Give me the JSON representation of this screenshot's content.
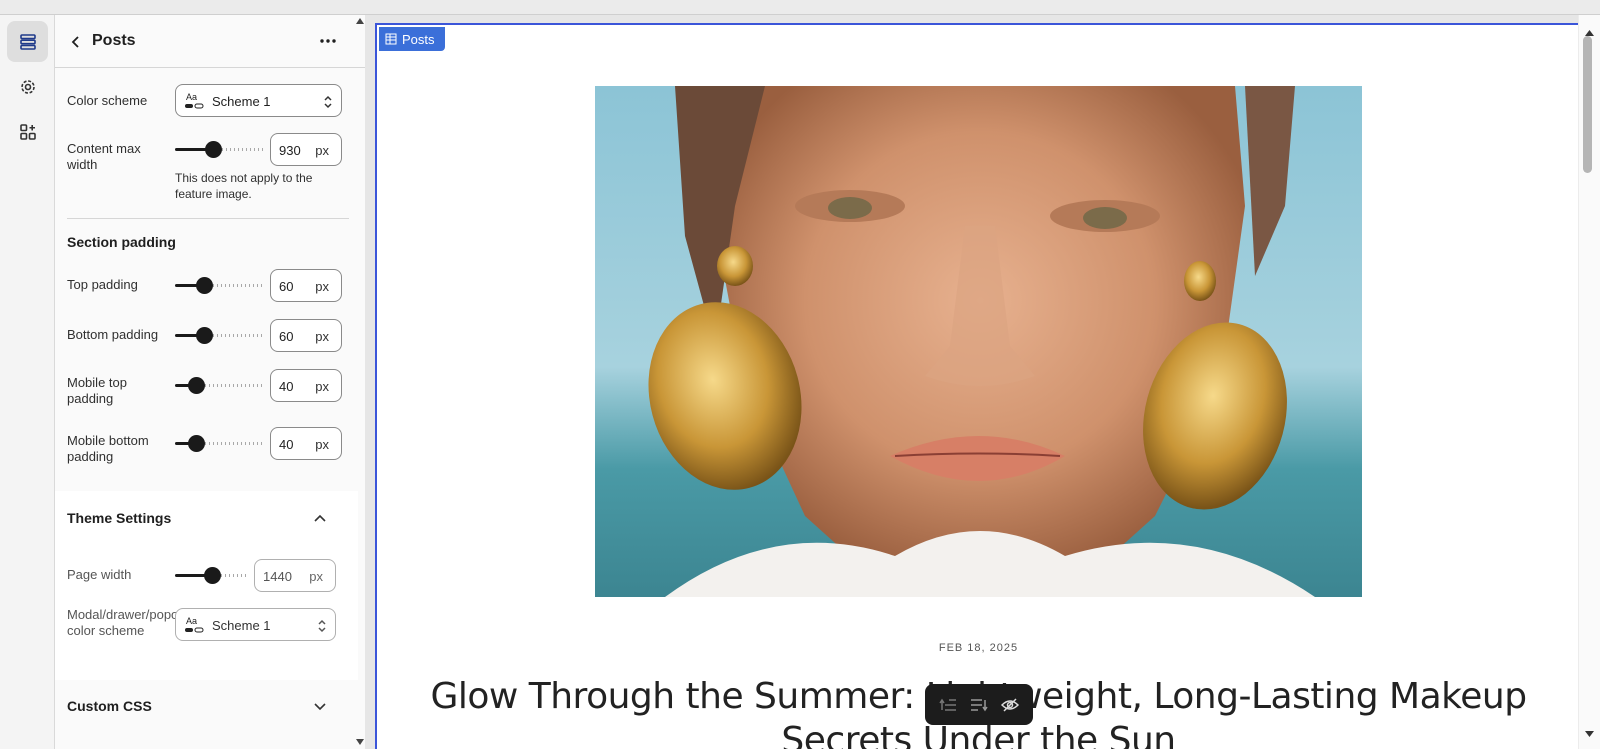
{
  "panel": {
    "title": "Posts",
    "color_scheme_label": "Color scheme",
    "color_scheme_value": "Scheme 1",
    "content_max_width_label": "Content max width",
    "content_max_width_value": "930",
    "content_max_width_level": 0.42,
    "content_max_width_help": "This does not apply to the feature image.",
    "section_padding_heading": "Section padding",
    "top_padding_label": "Top padding",
    "top_padding_value": "60",
    "bottom_padding_label": "Bottom padding",
    "bottom_padding_value": "60",
    "mobile_top_padding_label": "Mobile top padding",
    "mobile_top_padding_value": "40",
    "mobile_bottom_padding_label": "Mobile bottom padding",
    "mobile_bottom_padding_value": "40",
    "unit": "px",
    "theme_settings_heading": "Theme Settings",
    "page_width_label": "Page width",
    "page_width_value": "1440",
    "modal_scheme_label": "Modal/drawer/popover color scheme",
    "modal_scheme_value": "Scheme 1",
    "custom_css_heading": "Custom CSS"
  },
  "preview": {
    "section_tag": "Posts",
    "date": "FEB 18, 2025",
    "title": "Glow Through the Summer: Lightweight, Long-Lasting Makeup Secrets Under the Sun",
    "accent_color": "#3b55d9"
  },
  "icons": {
    "rail": [
      "sections-icon",
      "gear-icon",
      "apps-icon"
    ],
    "toolbar": [
      "move-up-icon",
      "move-down-icon",
      "hide-icon"
    ]
  }
}
